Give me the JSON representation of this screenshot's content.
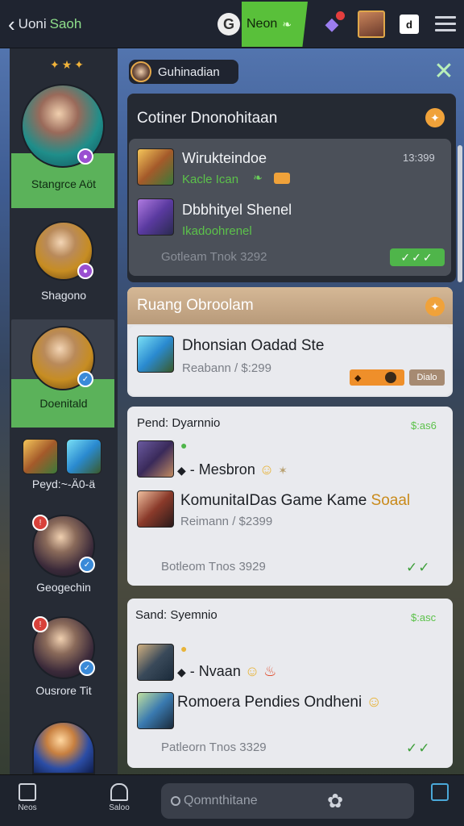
{
  "topbar": {
    "back_label_1": "Uoni",
    "back_label_2": "Saoh",
    "g_badge": "G",
    "neon_label": "Neon",
    "square_btn": "d"
  },
  "sidebar": {
    "items": [
      {
        "label": "Stangrce Aöt"
      },
      {
        "label": "Shagono"
      },
      {
        "label": "Doenitald"
      },
      {
        "label": "Peyd:~-Ä0-ä"
      },
      {
        "label": "Geogechin"
      },
      {
        "label": "Ousrore Tit"
      }
    ]
  },
  "channel": {
    "name": "Guhinadian"
  },
  "panel1": {
    "title": "Cotiner Dnonohitaan",
    "card": {
      "row1_title": "Wirukteindoe",
      "row1_time": "13:399",
      "row1_sub": "Kacle Ican",
      "row2_title": "Dbbhityel Shenel",
      "row2_sub": "Ikadoohrenel",
      "footer": "Gotleam Tnok 3292"
    }
  },
  "panel2": {
    "title": "Ruang Obroolam",
    "card": {
      "title": "Dhonsian Oadad Ste",
      "sub": "Reabann / $:299",
      "badge": "Dialo"
    }
  },
  "card3": {
    "header": "Pend: Dyarnnio",
    "price": "$:as6",
    "msg1": "- Mesbron",
    "msg2_title": "KomunitaIDas Game Kame",
    "msg2_title_accent": "Soaal",
    "msg2_sub": "Reimann / $2399",
    "footer": "Botleom Tnos 3929"
  },
  "card4": {
    "header": "Sand: Syemnio",
    "price": "$:asc",
    "msg1": "- Nvaan",
    "msg2_title": "Romoera Pendies Ondheni",
    "footer": "Patleorn Tnos 3329"
  },
  "bottom": {
    "nav_left1": "Neos",
    "nav_left2": "Saloo",
    "search_placeholder": "Qomnthitane",
    "nav_right": ""
  }
}
